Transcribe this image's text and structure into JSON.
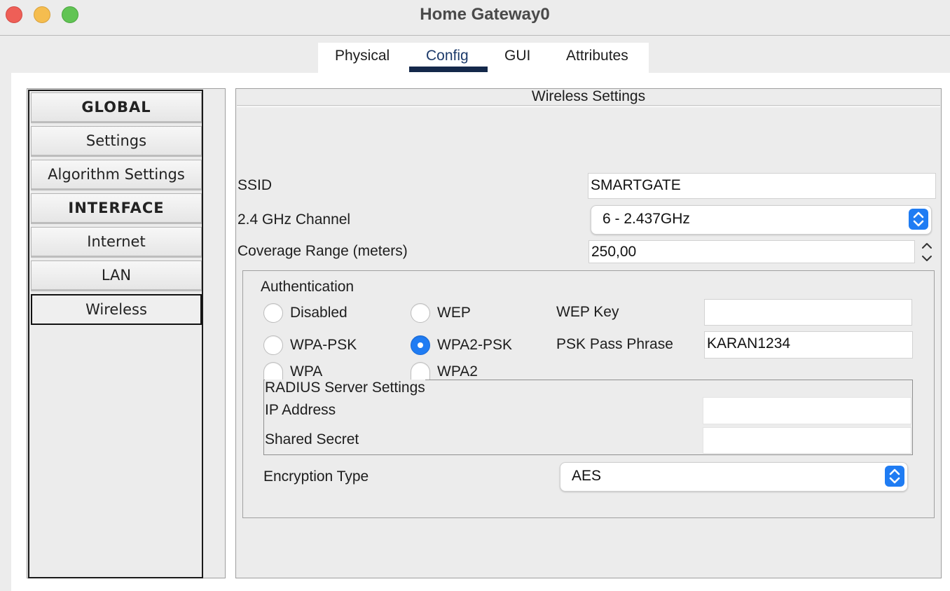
{
  "window": {
    "title": "Home Gateway0"
  },
  "tabs": [
    {
      "label": "Physical"
    },
    {
      "label": "Config",
      "active": true
    },
    {
      "label": "GUI"
    },
    {
      "label": "Attributes"
    }
  ],
  "sidebar": {
    "items": [
      {
        "label": "GLOBAL",
        "type": "header"
      },
      {
        "label": "Settings"
      },
      {
        "label": "Algorithm Settings"
      },
      {
        "label": "INTERFACE",
        "type": "header"
      },
      {
        "label": "Internet"
      },
      {
        "label": "LAN"
      },
      {
        "label": "Wireless",
        "selected": true
      }
    ]
  },
  "wireless": {
    "title": "Wireless Settings",
    "ssid_label": "SSID",
    "ssid_value": "SMARTGATE",
    "channel_label": "2.4 GHz Channel",
    "channel_value": "6 - 2.437GHz",
    "coverage_label": "Coverage Range (meters)",
    "coverage_value": "250,00",
    "auth": {
      "title": "Authentication",
      "options": [
        {
          "label": "Disabled",
          "checked": false
        },
        {
          "label": "WEP",
          "checked": false
        },
        {
          "label": "WPA-PSK",
          "checked": false
        },
        {
          "label": "WPA2-PSK",
          "checked": true
        },
        {
          "label": "WPA",
          "checked": false
        },
        {
          "label": "WPA2",
          "checked": false
        }
      ],
      "wep_key_label": "WEP Key",
      "wep_key_value": "",
      "psk_label": "PSK Pass Phrase",
      "psk_value": "KARAN1234"
    },
    "radius": {
      "title": "RADIUS Server Settings",
      "ip_label": "IP Address",
      "ip_value": "",
      "secret_label": "Shared Secret",
      "secret_value": ""
    },
    "encryption_label": "Encryption Type",
    "encryption_value": "AES"
  },
  "colors": {
    "accent": "#1f7cf3",
    "tab_underline": "#14284a"
  },
  "icons": {
    "close": "close-icon",
    "minimize": "minimize-icon",
    "zoom": "zoom-icon",
    "select_arrows": "chevron-updown-icon",
    "spinner": "stepper-icon"
  }
}
